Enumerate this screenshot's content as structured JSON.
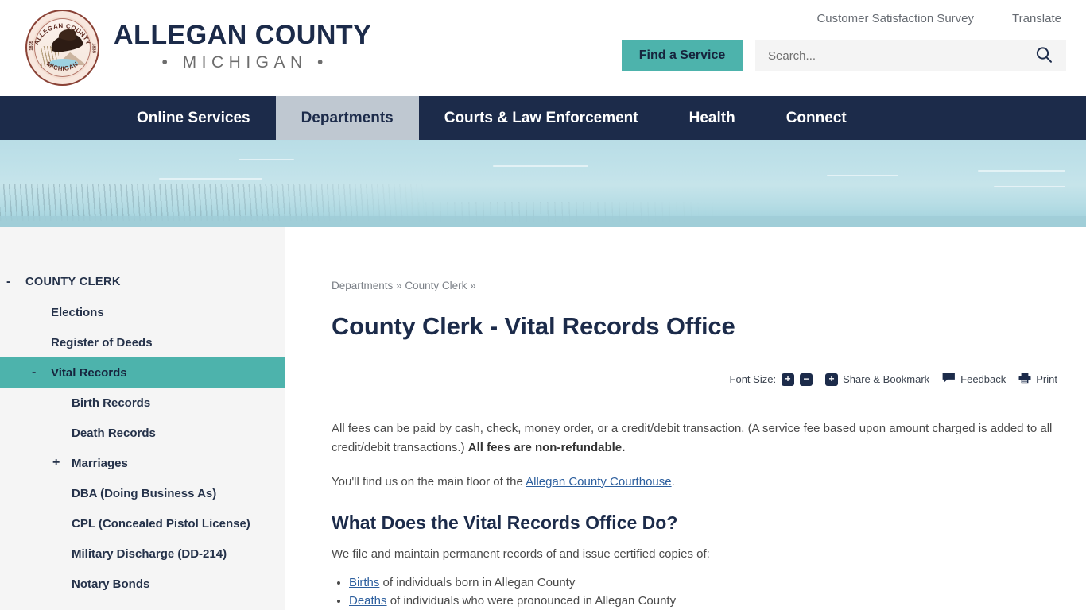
{
  "header": {
    "seal": {
      "top_text": "ALLEGAN COUNTY",
      "bottom_text": "MICHIGAN",
      "year_left": "1835",
      "year_right": "1835"
    },
    "brand_title": "ALLEGAN COUNTY",
    "brand_sub": "• MICHIGAN •",
    "util_links": [
      {
        "label": "Customer Satisfaction Survey"
      },
      {
        "label": "Translate"
      }
    ],
    "find_service_label": "Find a Service",
    "search": {
      "placeholder": "Search...",
      "value": "",
      "icon": "search-icon"
    }
  },
  "nav": {
    "items": [
      {
        "label": "Online Services",
        "active": false
      },
      {
        "label": "Departments",
        "active": true
      },
      {
        "label": "Courts & Law Enforcement",
        "active": false
      },
      {
        "label": "Health",
        "active": false
      },
      {
        "label": "Connect",
        "active": false
      }
    ]
  },
  "sidebar": {
    "items": [
      {
        "label": "COUNTY CLERK",
        "level": 0,
        "toggle": "-",
        "selected": false
      },
      {
        "label": "Elections",
        "level": 1,
        "toggle": "",
        "selected": false
      },
      {
        "label": "Register of Deeds",
        "level": 1,
        "toggle": "",
        "selected": false
      },
      {
        "label": "Vital Records",
        "level": 1,
        "toggle": "-",
        "selected": true
      },
      {
        "label": "Birth Records",
        "level": 2,
        "toggle": "",
        "selected": false
      },
      {
        "label": "Death Records",
        "level": 2,
        "toggle": "",
        "selected": false
      },
      {
        "label": "Marriages",
        "level": 2,
        "toggle": "+",
        "selected": false
      },
      {
        "label": "DBA (Doing Business As)",
        "level": 2,
        "toggle": "",
        "selected": false
      },
      {
        "label": "CPL (Concealed Pistol License)",
        "level": 2,
        "toggle": "",
        "selected": false
      },
      {
        "label": "Military Discharge (DD-214)",
        "level": 2,
        "toggle": "",
        "selected": false
      },
      {
        "label": "Notary Bonds",
        "level": 2,
        "toggle": "",
        "selected": false
      }
    ]
  },
  "main": {
    "breadcrumb": {
      "parts": [
        "Departments",
        "County Clerk"
      ],
      "separator": " » ",
      "trailing": " »"
    },
    "page_title": "County Clerk - Vital Records Office",
    "toolbar": {
      "font_size_label": "Font Size:",
      "increase_label": "+",
      "decrease_label": "−",
      "share_plus_label": "+",
      "share_label": "Share & Bookmark",
      "feedback_label": "Feedback",
      "print_label": "Print"
    },
    "paragraph_1": {
      "text_before": "All fees can be paid by cash, check, money order, or a credit/debit transaction. (A service fee based upon amount charged is added to all credit/debit transactions.) ",
      "bold": "All fees are non-refundable."
    },
    "paragraph_2": {
      "text_before": "You'll find us on the main floor of the ",
      "link": "Allegan County Courthouse",
      "text_after": "."
    },
    "section_heading": "What Does the Vital Records Office Do?",
    "section_intro": "We file and maintain permanent records of and issue certified copies of:",
    "bullets": [
      {
        "link": "Births",
        "rest": " of individuals born in Allegan County"
      },
      {
        "link": "Deaths",
        "rest": " of individuals who were pronounced in Allegan County"
      }
    ]
  },
  "colors": {
    "navy": "#1C2B4A",
    "teal": "#4DB3AC",
    "nav_active_bg": "#BFC8D1",
    "sidebar_bg": "#F5F5F5",
    "link_blue": "#2D5F9E",
    "banner_blue": "#BFE1E9"
  }
}
